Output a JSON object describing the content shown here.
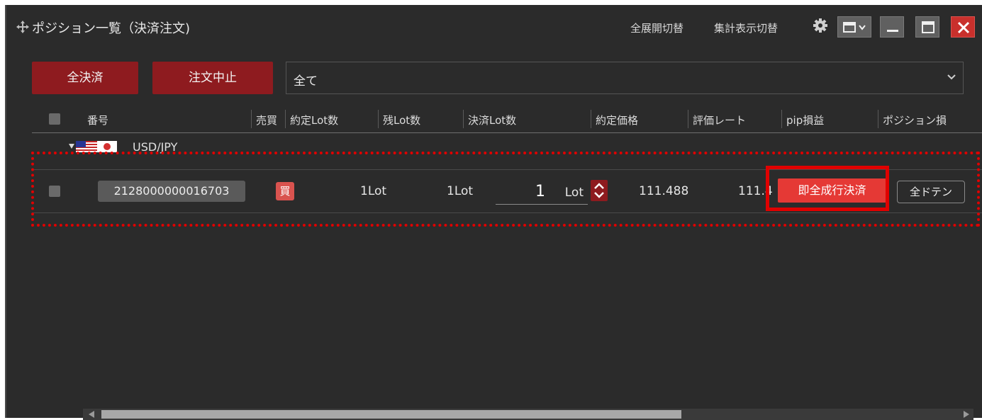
{
  "window": {
    "title": "ポジション一覧（決済注文)",
    "expand_toggle": "全展開切替",
    "summary_toggle": "集計表示切替",
    "icons": [
      "move-icon",
      "gear-icon",
      "layout-dropdown-icon",
      "minimize-icon",
      "maximize-icon",
      "close-icon"
    ]
  },
  "toolbar": {
    "settle_all_label": "全決済",
    "cancel_order_label": "注文中止",
    "filter_value": "全て"
  },
  "table": {
    "columns": [
      "番号",
      "売買",
      "約定Lot数",
      "残Lot数",
      "決済Lot数",
      "約定価格",
      "評価レート",
      "pip損益",
      "ポジション損"
    ],
    "group": {
      "pair": "USD/JPY",
      "flag": "us-jp-flag-icon"
    },
    "rows": [
      {
        "position_number": "2128000000016703",
        "side": "買",
        "filled_lot": "1Lot",
        "remaining_lot": "1Lot",
        "settle_lot_value": "1",
        "settle_lot_unit": "Lot",
        "fill_price": "111.488",
        "eval_rate": "111.4",
        "market_settle_label": "即全成行決済",
        "doten_label": "全ドテン"
      }
    ]
  },
  "colors": {
    "background": "#2b2b2b",
    "action_button": "#8e1b1f",
    "market_button": "#e53935",
    "highlight": "#e00000"
  }
}
